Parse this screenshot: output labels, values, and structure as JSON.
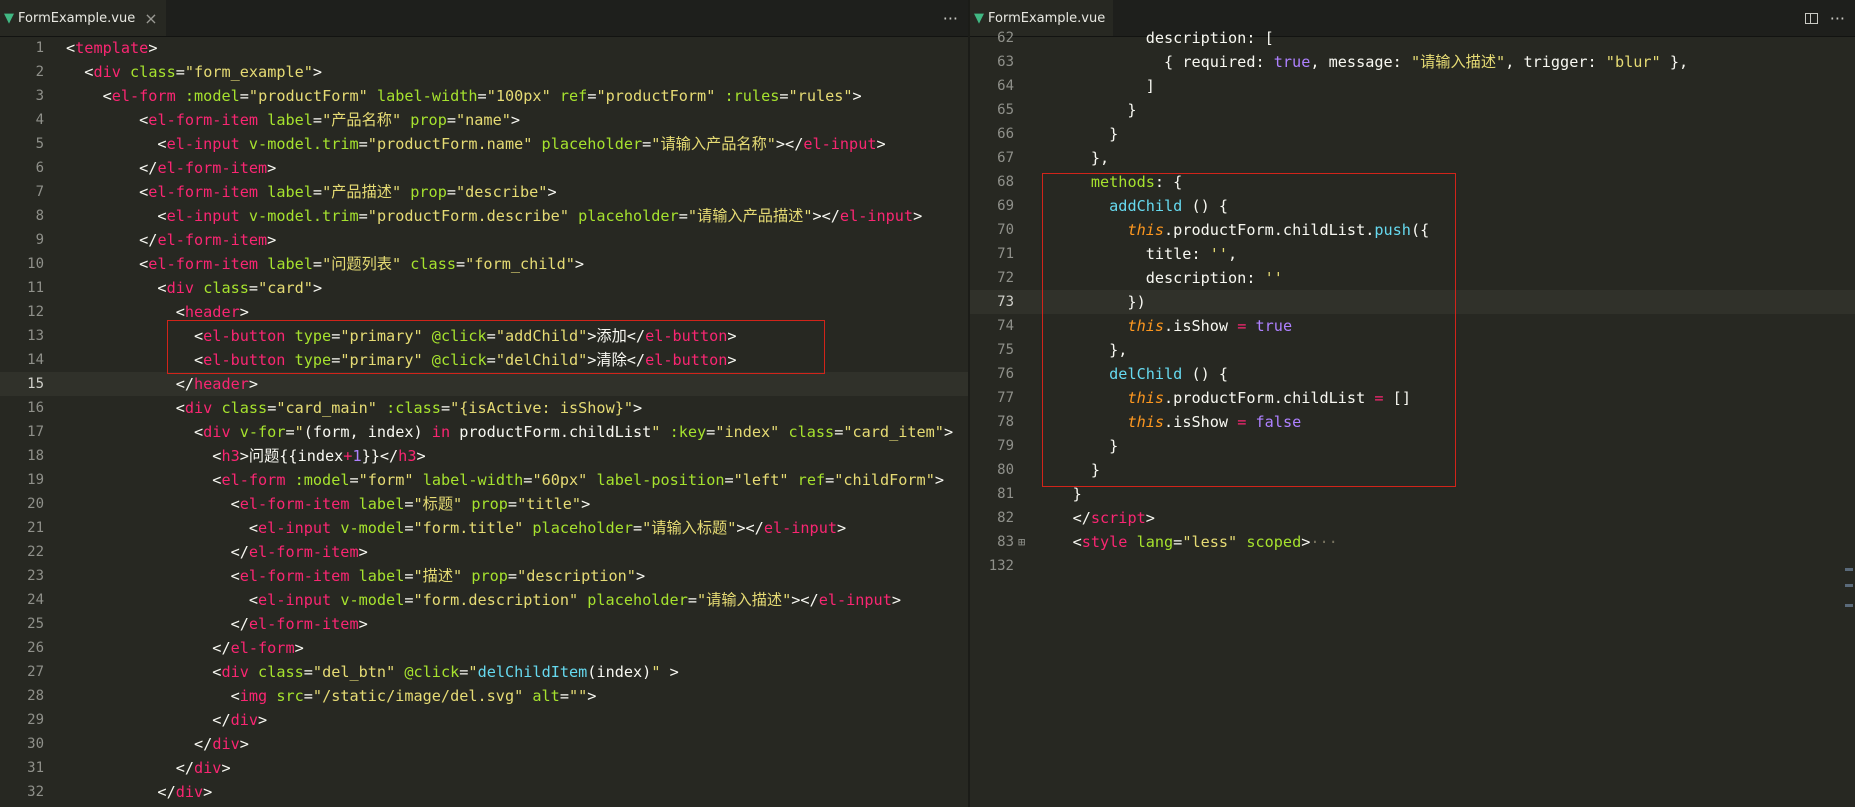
{
  "left": {
    "tab": {
      "title": "FormExample.vue",
      "close": "×"
    },
    "actions": {
      "more": "···"
    },
    "lines": [
      {
        "n": "1",
        "h": "&lt;<span class=\"t\">template</span>&gt;"
      },
      {
        "n": "2",
        "h": "  &lt;<span class=\"t\">div</span> <span class=\"a\">class</span>=<span class=\"s\">\"form_example\"</span>&gt;"
      },
      {
        "n": "3",
        "h": "    &lt;<span class=\"t\">el-form</span> <span class=\"a\">:model</span>=<span class=\"s\">\"productForm\"</span> <span class=\"a\">label-width</span>=<span class=\"s\">\"100px\"</span> <span class=\"a\">ref</span>=<span class=\"s\">\"productForm\"</span> <span class=\"a\">:rules</span>=<span class=\"s\">\"rules\"</span>&gt;"
      },
      {
        "n": "4",
        "h": "        &lt;<span class=\"t\">el-form-item</span> <span class=\"a\">label</span>=<span class=\"s\">\"产品名称\"</span> <span class=\"a\">prop</span>=<span class=\"s\">\"name\"</span>&gt;"
      },
      {
        "n": "5",
        "h": "          &lt;<span class=\"t\">el-input</span> <span class=\"a\">v-model.trim</span>=<span class=\"s\">\"productForm.name\"</span> <span class=\"a\">placeholder</span>=<span class=\"s\">\"请输入产品名称\"</span>&gt;&lt;/<span class=\"t\">el-input</span>&gt;"
      },
      {
        "n": "6",
        "h": "        &lt;/<span class=\"t\">el-form-item</span>&gt;"
      },
      {
        "n": "7",
        "h": "        &lt;<span class=\"t\">el-form-item</span> <span class=\"a\">label</span>=<span class=\"s\">\"产品描述\"</span> <span class=\"a\">prop</span>=<span class=\"s\">\"describe\"</span>&gt;"
      },
      {
        "n": "8",
        "h": "          &lt;<span class=\"t\">el-input</span> <span class=\"a\">v-model.trim</span>=<span class=\"s\">\"productForm.describe\"</span> <span class=\"a\">placeholder</span>=<span class=\"s\">\"请输入产品描述\"</span>&gt;&lt;/<span class=\"t\">el-input</span>&gt;"
      },
      {
        "n": "9",
        "h": "        &lt;/<span class=\"t\">el-form-item</span>&gt;"
      },
      {
        "n": "10",
        "h": "        &lt;<span class=\"t\">el-form-item</span> <span class=\"a\">label</span>=<span class=\"s\">\"问题列表\"</span> <span class=\"a\">class</span>=<span class=\"s\">\"form_child\"</span>&gt;"
      },
      {
        "n": "11",
        "h": "          &lt;<span class=\"t\">div</span> <span class=\"a\">class</span>=<span class=\"s\">\"card\"</span>&gt;"
      },
      {
        "n": "12",
        "h": "            &lt;<span class=\"t\">header</span>&gt;"
      },
      {
        "n": "13",
        "h": "              &lt;<span class=\"t\">el-button</span> <span class=\"a\">type</span>=<span class=\"s\">\"primary\"</span> <span class=\"a\">@click</span>=<span class=\"s\">\"addChild\"</span>&gt;添加&lt;/<span class=\"t\">el-button</span>&gt;"
      },
      {
        "n": "14",
        "h": "              &lt;<span class=\"t\">el-button</span> <span class=\"a\">type</span>=<span class=\"s\">\"primary\"</span> <span class=\"a\">@click</span>=<span class=\"s\">\"delChild\"</span>&gt;清除&lt;/<span class=\"t\">el-button</span>&gt;"
      },
      {
        "n": "15",
        "h": "            &lt;/<span class=\"t\">header</span>&gt;"
      },
      {
        "n": "16",
        "h": "            &lt;<span class=\"t\">div</span> <span class=\"a\">class</span>=<span class=\"s\">\"card_main\"</span> <span class=\"a\">:class</span>=<span class=\"s\">\"{isActive: isShow}\"</span>&gt;"
      },
      {
        "n": "17",
        "h": "              &lt;<span class=\"t\">div</span> <span class=\"a\">v-for</span>=<span class=\"s\">\"</span><span class=\"w\">(form, index) </span><span class=\"k\">in</span><span class=\"w\"> productForm.childList</span><span class=\"s\">\"</span> <span class=\"a\">:key</span>=<span class=\"s\">\"index\"</span> <span class=\"a\">class</span>=<span class=\"s\">\"card_item\"</span>&gt;"
      },
      {
        "n": "18",
        "h": "                &lt;<span class=\"t\">h3</span>&gt;问题{{<span class=\"w\">index</span><span class=\"k\">+</span><span class=\"n\">1</span>}}&lt;/<span class=\"t\">h3</span>&gt;"
      },
      {
        "n": "19",
        "h": "                &lt;<span class=\"t\">el-form</span> <span class=\"a\">:model</span>=<span class=\"s\">\"form\"</span> <span class=\"a\">label-width</span>=<span class=\"s\">\"60px\"</span> <span class=\"a\">label-position</span>=<span class=\"s\">\"left\"</span> <span class=\"a\">ref</span>=<span class=\"s\">\"childForm\"</span>&gt;"
      },
      {
        "n": "20",
        "h": "                  &lt;<span class=\"t\">el-form-item</span> <span class=\"a\">label</span>=<span class=\"s\">\"标题\"</span> <span class=\"a\">prop</span>=<span class=\"s\">\"title\"</span>&gt;"
      },
      {
        "n": "21",
        "h": "                    &lt;<span class=\"t\">el-input</span> <span class=\"a\">v-model</span>=<span class=\"s\">\"form.title\"</span> <span class=\"a\">placeholder</span>=<span class=\"s\">\"请输入标题\"</span>&gt;&lt;/<span class=\"t\">el-input</span>&gt;"
      },
      {
        "n": "22",
        "h": "                  &lt;/<span class=\"t\">el-form-item</span>&gt;"
      },
      {
        "n": "23",
        "h": "                  &lt;<span class=\"t\">el-form-item</span> <span class=\"a\">label</span>=<span class=\"s\">\"描述\"</span> <span class=\"a\">prop</span>=<span class=\"s\">\"description\"</span>&gt;"
      },
      {
        "n": "24",
        "h": "                    &lt;<span class=\"t\">el-input</span> <span class=\"a\">v-model</span>=<span class=\"s\">\"form.description\"</span> <span class=\"a\">placeholder</span>=<span class=\"s\">\"请输入描述\"</span>&gt;&lt;/<span class=\"t\">el-input</span>&gt;"
      },
      {
        "n": "25",
        "h": "                  &lt;/<span class=\"t\">el-form-item</span>&gt;"
      },
      {
        "n": "26",
        "h": "                &lt;/<span class=\"t\">el-form</span>&gt;"
      },
      {
        "n": "27",
        "h": "                &lt;<span class=\"t\">div</span> <span class=\"a\">class</span>=<span class=\"s\">\"del_btn\"</span> <span class=\"a\">@click</span>=<span class=\"s\">\"</span><span class=\"b\">delChildItem</span><span class=\"w\">(index)</span><span class=\"s\">\"</span> &gt;"
      },
      {
        "n": "28",
        "h": "                  &lt;<span class=\"t\">img</span> <span class=\"a\">src</span>=<span class=\"s\">\"/static/image/del.svg\"</span> <span class=\"a\">alt</span>=<span class=\"s\">\"\"</span>&gt;"
      },
      {
        "n": "29",
        "h": "                &lt;/<span class=\"t\">div</span>&gt;"
      },
      {
        "n": "30",
        "h": "              &lt;/<span class=\"t\">div</span>&gt;"
      },
      {
        "n": "31",
        "h": "            &lt;/<span class=\"t\">div</span>&gt;"
      },
      {
        "n": "32",
        "h": "          &lt;/<span class=\"t\">div</span>&gt;"
      }
    ]
  },
  "right": {
    "tab": {
      "title": "FormExample.vue"
    },
    "actions": {
      "more": "···"
    },
    "lines": [
      {
        "n": "62",
        "h": "            <span class=\"w\">description: [</span>"
      },
      {
        "n": "63",
        "h": "              { <span class=\"w\">required</span>: <span class=\"n\">true</span>, <span class=\"w\">message</span>: <span class=\"s\">\"请输入描述\"</span>, <span class=\"w\">trigger</span>: <span class=\"s\">\"blur\"</span> },"
      },
      {
        "n": "64",
        "h": "            ]"
      },
      {
        "n": "65",
        "h": "          }"
      },
      {
        "n": "66",
        "h": "        }"
      },
      {
        "n": "67",
        "h": "      },"
      },
      {
        "n": "68",
        "h": "      <span class=\"a\">methods</span>: {"
      },
      {
        "n": "69",
        "h": "        <span class=\"b\">addChild</span> () {"
      },
      {
        "n": "70",
        "h": "          <span class=\"th\">this</span>.<span class=\"w\">productForm</span>.<span class=\"w\">childList</span>.<span class=\"b\">push</span>({"
      },
      {
        "n": "71",
        "h": "            <span class=\"w\">title</span>: <span class=\"s\">''</span>,"
      },
      {
        "n": "72",
        "h": "            <span class=\"w\">description</span>: <span class=\"s\">''</span>"
      },
      {
        "n": "73",
        "h": "          })"
      },
      {
        "n": "74",
        "h": "          <span class=\"th\">this</span>.<span class=\"w\">isShow</span> <span class=\"k\">=</span> <span class=\"n\">true</span>"
      },
      {
        "n": "75",
        "h": "        },"
      },
      {
        "n": "76",
        "h": "        <span class=\"b\">delChild</span> () {"
      },
      {
        "n": "77",
        "h": "          <span class=\"th\">this</span>.<span class=\"w\">productForm</span>.<span class=\"w\">childList</span> <span class=\"k\">=</span> []"
      },
      {
        "n": "78",
        "h": "          <span class=\"th\">this</span>.<span class=\"w\">isShow</span> <span class=\"k\">=</span> <span class=\"n\">false</span>"
      },
      {
        "n": "79",
        "h": "        }"
      },
      {
        "n": "80",
        "h": "      }"
      },
      {
        "n": "81",
        "h": "    }"
      },
      {
        "n": "82",
        "h": "    &lt;/<span class=\"t\">script</span>&gt;"
      },
      {
        "n": "83",
        "h": "    &lt;<span class=\"t\">style</span> <span class=\"a\">lang</span>=<span class=\"s\">\"less\"</span> <span class=\"a\">scoped</span>&gt;<span class=\"g\">···</span>"
      },
      {
        "n": "132",
        "h": ""
      }
    ]
  },
  "colors": {
    "bg": "#272822",
    "tag": "#f92672",
    "attr": "#a6e22e",
    "string": "#e6db74",
    "func": "#66d9ef",
    "number": "#ae81ff",
    "this": "#fd971f",
    "highlight": "#d1241a"
  },
  "icons": {
    "vue": "vue-logo-icon",
    "split": "split-editor-icon",
    "more": "more-actions-icon",
    "close": "close-icon"
  }
}
